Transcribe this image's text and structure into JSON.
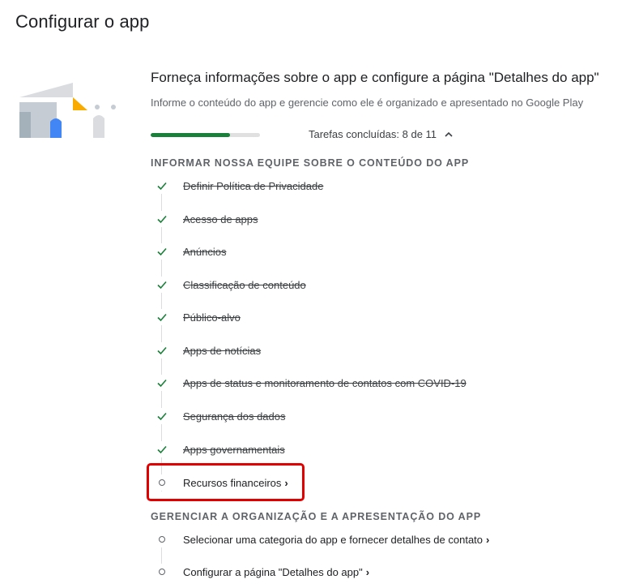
{
  "page": {
    "title": "Configurar o app"
  },
  "card": {
    "heading": "Forneça informações sobre o app e configure a página \"Detalhes do app\"",
    "subheading": "Informe o conteúdo do app e gerencie como ele é organizado e apresentado no Google Play",
    "progress": {
      "completed": 8,
      "total": 11,
      "label": "Tarefas concluídas: 8 de 11",
      "fill_color": "#188038"
    }
  },
  "sections": [
    {
      "header": "INFORMAR NOSSA EQUIPE SOBRE O CONTEÚDO DO APP",
      "tasks": [
        {
          "label": "Definir Política de Privacidade",
          "status": "done"
        },
        {
          "label": "Acesso de apps",
          "status": "done"
        },
        {
          "label": "Anúncios",
          "status": "done"
        },
        {
          "label": "Classificação de conteúdo",
          "status": "done"
        },
        {
          "label": "Público-alvo",
          "status": "done"
        },
        {
          "label": "Apps de notícias",
          "status": "done"
        },
        {
          "label": "Apps de status e monitoramento de contatos com COVID-19",
          "status": "done"
        },
        {
          "label": "Segurança dos dados",
          "status": "done"
        },
        {
          "label": "Apps governamentais",
          "status": "done"
        },
        {
          "label": "Recursos financeiros",
          "status": "todo"
        }
      ]
    },
    {
      "header": "GERENCIAR A ORGANIZAÇÃO E A APRESENTAÇÃO DO APP",
      "tasks": [
        {
          "label": "Selecionar uma categoria do app e fornecer detalhes de contato",
          "status": "todo"
        },
        {
          "label": "Configurar a página \"Detalhes do app\"",
          "status": "todo"
        }
      ]
    }
  ],
  "icons": {
    "done": "check-icon",
    "todo": "circle-icon",
    "collapse": "chevron-up-icon",
    "navigate": "chevron-right-icon"
  },
  "colors": {
    "check": "#188038",
    "highlight": "#e00000",
    "accent_blue": "#4285f4",
    "accent_yellow": "#f9ab00"
  }
}
